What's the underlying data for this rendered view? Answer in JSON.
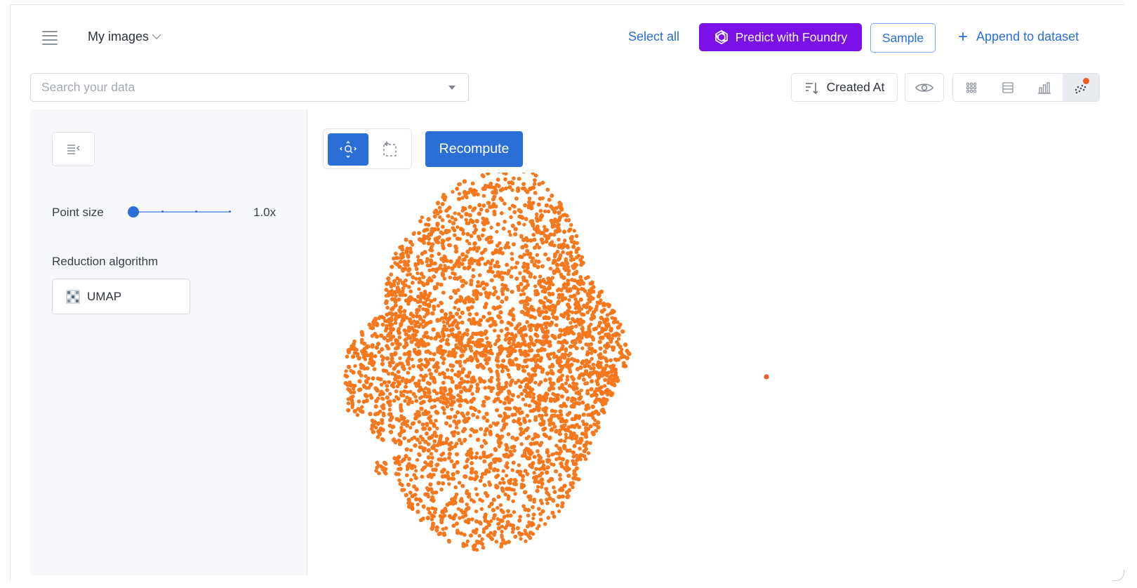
{
  "header": {
    "dataset_title": "My images",
    "select_all": "Select all",
    "predict_button": "Predict with Foundry",
    "sample_button": "Sample",
    "append_button": "Append to dataset"
  },
  "search": {
    "placeholder": "Search your data"
  },
  "toolbar": {
    "sort_label": "Created At",
    "views": [
      "grid-view-icon",
      "list-view-icon",
      "chart-view-icon",
      "embedding-view-icon"
    ],
    "active_view": "embedding-view-icon"
  },
  "panel": {
    "point_size_label": "Point size",
    "point_size_value": "1.0x",
    "point_size_level": 0.0,
    "reduction_label": "Reduction algorithm",
    "reduction_value": "UMAP"
  },
  "plot": {
    "recompute_label": "Recompute",
    "tools": [
      "pan-zoom-icon",
      "box-select-icon"
    ],
    "active_tool": "pan-zoom-icon"
  },
  "colors": {
    "accent": "#2b6fd6",
    "foundry": "#7b11e6",
    "points": "#f5781e",
    "notification": "#f05a23"
  }
}
